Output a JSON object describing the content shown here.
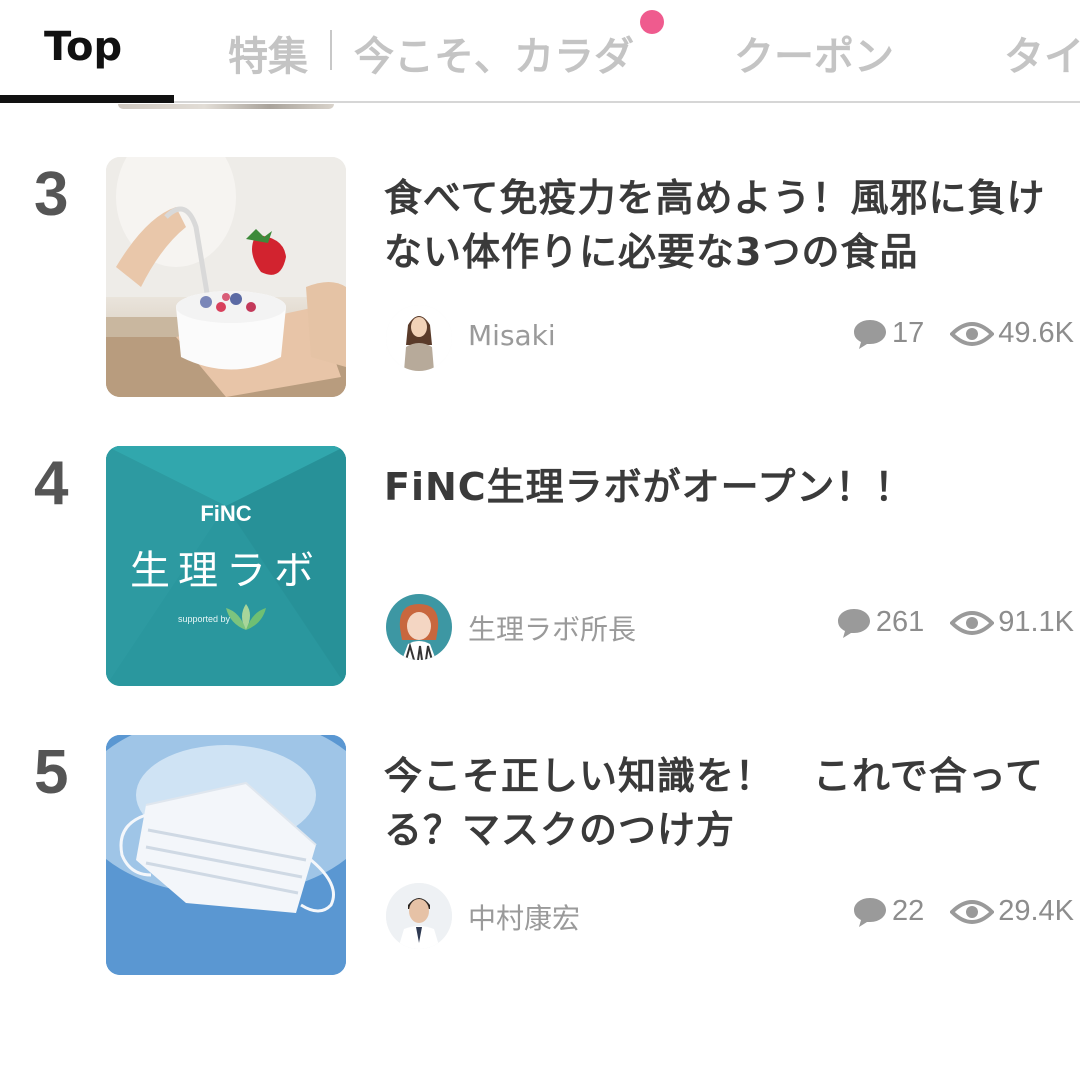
{
  "tabs": [
    {
      "label": "Top",
      "active": true
    },
    {
      "label": "特集"
    },
    {
      "label": "今こそ、カラダ",
      "has_dot": true
    },
    {
      "label": "クーポン"
    },
    {
      "label": "タイ"
    }
  ],
  "articles": [
    {
      "rank": "3",
      "title": "食べて免疫力を高めよう！風邪に負けない体作りに必要な3つの食品",
      "author": "Misaki",
      "comments": "17",
      "views": "49.6K",
      "thumbnail": "yogurt-photo"
    },
    {
      "rank": "4",
      "title": "FiNC生理ラボがオープン！！",
      "author": "生理ラボ所長",
      "comments": "261",
      "views": "91.1K",
      "thumbnail": "finc-seiri-lab-logo",
      "thumb_brand": "FiNC",
      "thumb_title": "生理ラボ",
      "thumb_supported": "supported by"
    },
    {
      "rank": "5",
      "title": "今こそ正しい知識を！　これで合ってる？マスクのつけ方",
      "author": "中村康宏",
      "comments": "22",
      "views": "29.4K",
      "thumbnail": "face-mask-photo"
    }
  ],
  "colors": {
    "accent_dot": "#ef5b8e",
    "finc_teal": "#2c9aa1",
    "active_tab": "#111111",
    "inactive_tab": "#c4c4c4"
  },
  "icons": [
    "comment-icon",
    "eye-icon"
  ]
}
